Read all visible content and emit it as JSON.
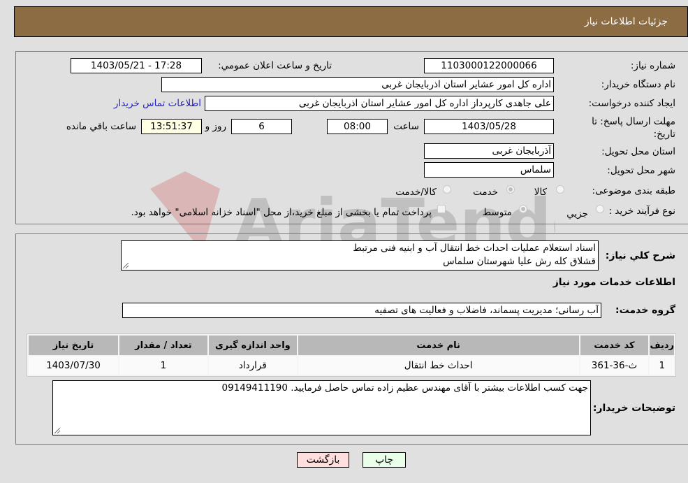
{
  "header": {
    "title": "جزئیات اطلاعات نیاز"
  },
  "fields": {
    "need_number": {
      "label": "شماره نیاز:",
      "value": "1103000122000066"
    },
    "announce": {
      "label": "تاریخ و ساعت اعلان عمومي:",
      "value": "1403/05/21 - 17:28"
    },
    "buyer_org": {
      "label": "نام دستگاه خریدار:",
      "value": "اداره کل امور عشایر استان اذربایجان غربی"
    },
    "requester": {
      "label": "ایجاد کننده درخواست:",
      "value": "علی جاهدی کارپرداز اداره کل امور عشایر استان اذربایجان غربی",
      "contact_link": "اطلاعات تماس خریدار"
    },
    "deadline": {
      "label": "مهلت ارسال پاسخ: تا تاریخ:",
      "date": "1403/05/28",
      "time_label": "ساعت",
      "time": "08:00",
      "days": "6",
      "days_label": "روز و",
      "remaining": "13:51:37",
      "remaining_label": "ساعت باقي مانده"
    },
    "province": {
      "label": "استان محل تحویل:",
      "value": "آذربایجان غربی"
    },
    "city": {
      "label": "شهر محل تحویل:",
      "value": "سلماس"
    },
    "category": {
      "label": "طبقه بندی موضوعی:",
      "options": [
        "کالا",
        "خدمت",
        "کالا/خدمت"
      ],
      "selected": "خدمت"
    },
    "purchase_type": {
      "label": "نوع فرآیند خرید :",
      "options": [
        "جزیي",
        "متوسط"
      ],
      "selected": "متوسط",
      "treasury_note": "پرداخت تمام یا بخشی از مبلغ خرید،از محل \"اسناد خزانه اسلامی\" خواهد بود."
    }
  },
  "description": {
    "label": "شرح کلي نیاز:",
    "line1": "اسناد استعلام عملیات احداث خط انتقال آب و ابنیه فنی مرتبط",
    "line2": "قشلاق کله رش علیا شهرستان سلماس"
  },
  "services": {
    "section_title": "اطلاعات خدمات مورد نیاز",
    "group_label": "گروه خدمت:",
    "group_value": "آب رسانی؛ مدیریت پسماند، فاضلاب و فعالیت های تصفیه",
    "table": {
      "headers": [
        "ردیف",
        "کد خدمت",
        "نام خدمت",
        "واحد اندازه گیری",
        "تعداد / مقدار",
        "تاریخ نیاز"
      ],
      "rows": [
        [
          "1",
          "ث-36-361",
          "احداث خط انتقال",
          "قرارداد",
          "1",
          "1403/07/30"
        ]
      ]
    }
  },
  "buyer_notes": {
    "label": "توضیحات خریدار:",
    "value": "جهت کسب اطلاعات بیشتر با آقای مهندس عظیم زاده تماس حاصل فرمایید. 09149411190"
  },
  "buttons": {
    "print": "چاپ",
    "back": "بازگشت"
  },
  "watermark": {
    "text": "AriaTender.neT"
  },
  "colors": {
    "header_bg": "#8b6c43",
    "link": "#2525c8",
    "print_bg": "#eaffea",
    "back_bg": "#ffdede",
    "remaining_bg": "#ffffe6"
  }
}
